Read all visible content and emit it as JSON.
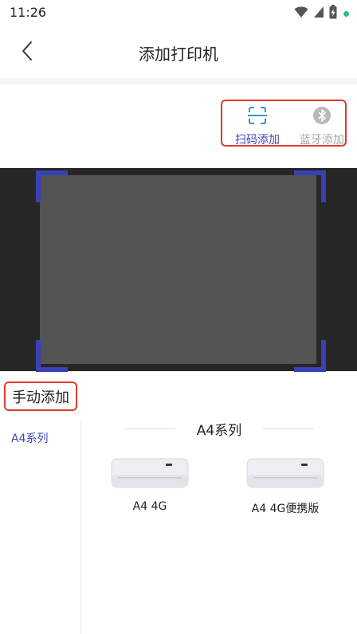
{
  "status_bar": {
    "time": "11:26",
    "icons": [
      "wifi-icon",
      "signal-icon",
      "battery-charging-icon",
      "notification-dot-icon"
    ],
    "dot_color": "#2ec27e"
  },
  "header": {
    "title": "添加打印机",
    "back_icon": "chevron-left-icon"
  },
  "add_methods": [
    {
      "label": "扫码添加",
      "icon": "scan-icon",
      "active": true,
      "color": "#3a47b9"
    },
    {
      "label": "蓝牙添加",
      "icon": "bluetooth-icon",
      "active": false,
      "color": "#a8a8a8"
    }
  ],
  "scanner": {
    "frame_color": "#3942b5",
    "background_color": "#262626",
    "area_color": "#545454"
  },
  "manual": {
    "title": "手动添加",
    "categories": [
      {
        "label": "A4系列",
        "selected": true
      }
    ],
    "series_title": "A4系列",
    "products": [
      {
        "name": "A4 4G"
      },
      {
        "name": "A4 4G便携版"
      }
    ]
  },
  "colors": {
    "accent": "#3a47b9",
    "highlight_border": "#e0392f"
  }
}
